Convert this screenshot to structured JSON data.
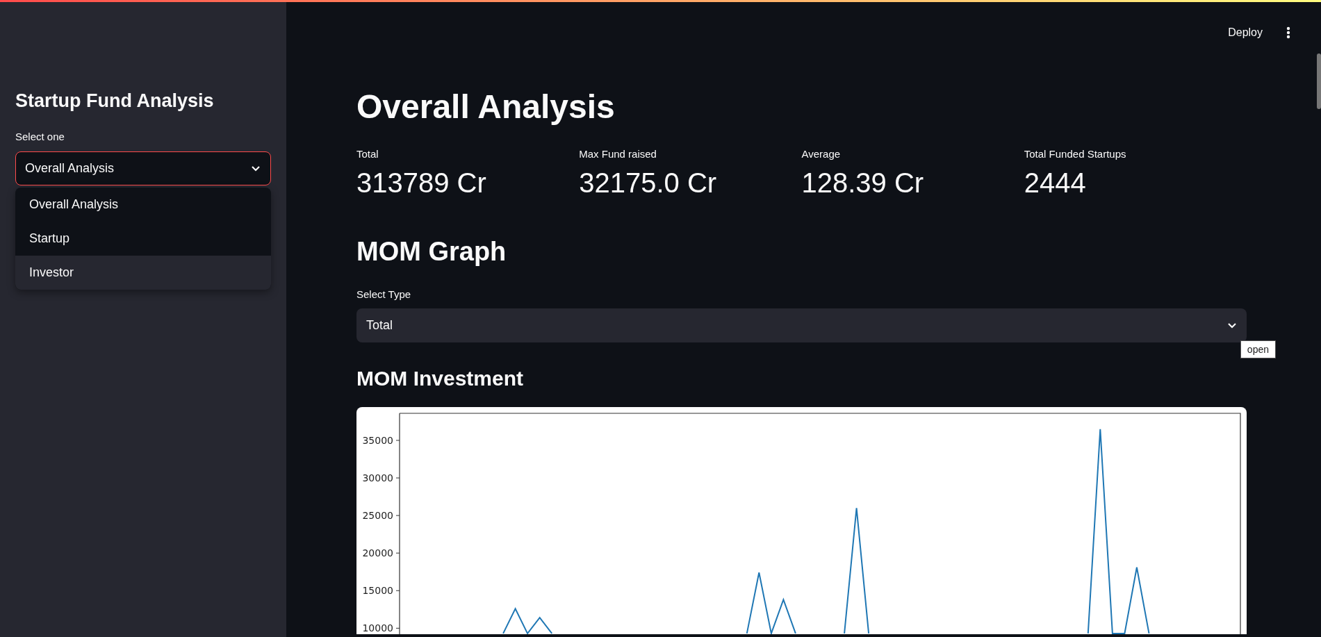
{
  "sidebar": {
    "title": "Startup Fund Analysis",
    "select": {
      "label": "Select one",
      "value": "Overall Analysis",
      "expanded": true,
      "options": [
        {
          "label": "Overall Analysis",
          "hovered": false
        },
        {
          "label": "Startup",
          "hovered": false
        },
        {
          "label": "Investor",
          "hovered": true
        }
      ]
    }
  },
  "header": {
    "deploy": "Deploy"
  },
  "main": {
    "title": "Overall Analysis",
    "metrics": [
      {
        "label": "Total",
        "value": "313789 Cr"
      },
      {
        "label": "Max Fund raised",
        "value": "32175.0 Cr"
      },
      {
        "label": "Average",
        "value": "128.39 Cr"
      },
      {
        "label": "Total Funded Startups",
        "value": "2444"
      }
    ],
    "graph_heading": "MOM Graph",
    "type_select": {
      "label": "Select Type",
      "value": "Total",
      "tooltip": "open"
    },
    "chart_heading": "MOM Investment",
    "chart_data": {
      "type": "line",
      "ylim": [
        9200,
        38600
      ],
      "yticks": [
        {
          "value": 10000,
          "label": "10000"
        },
        {
          "value": 15000,
          "label": "15000"
        },
        {
          "value": 20000,
          "label": "20000"
        },
        {
          "value": 25000,
          "label": "25000"
        },
        {
          "value": 30000,
          "label": "30000"
        },
        {
          "value": 35000,
          "label": "35000"
        }
      ],
      "categories": [
        null,
        null,
        null,
        null,
        null,
        null,
        null,
        null,
        null,
        null,
        null,
        null,
        null,
        null,
        null,
        null,
        null,
        null,
        null,
        null,
        null,
        null,
        null,
        null,
        null,
        null,
        null,
        null,
        null,
        null,
        null,
        null,
        null,
        null,
        null,
        null,
        null,
        null,
        null,
        null,
        null,
        null,
        null,
        null,
        null,
        null,
        null,
        null,
        null,
        null,
        null,
        null,
        null,
        null,
        null,
        null,
        null,
        null,
        null,
        null,
        null,
        null,
        null,
        null,
        null,
        null,
        null,
        null,
        null
      ],
      "series": [
        {
          "color": "#1f77b4",
          "values": [
            null,
            null,
            null,
            null,
            null,
            null,
            null,
            null,
            9300,
            12600,
            9300,
            11400,
            9300,
            null,
            null,
            null,
            null,
            null,
            null,
            null,
            null,
            null,
            null,
            null,
            null,
            null,
            null,
            null,
            9300,
            17400,
            9300,
            13800,
            9300,
            null,
            null,
            null,
            9300,
            26000,
            9300,
            null,
            null,
            null,
            null,
            null,
            null,
            null,
            null,
            null,
            null,
            null,
            null,
            null,
            null,
            null,
            null,
            null,
            9300,
            36500,
            9300,
            9300,
            18100,
            9300,
            null,
            null,
            null,
            null,
            null,
            null,
            null
          ]
        }
      ]
    }
  }
}
